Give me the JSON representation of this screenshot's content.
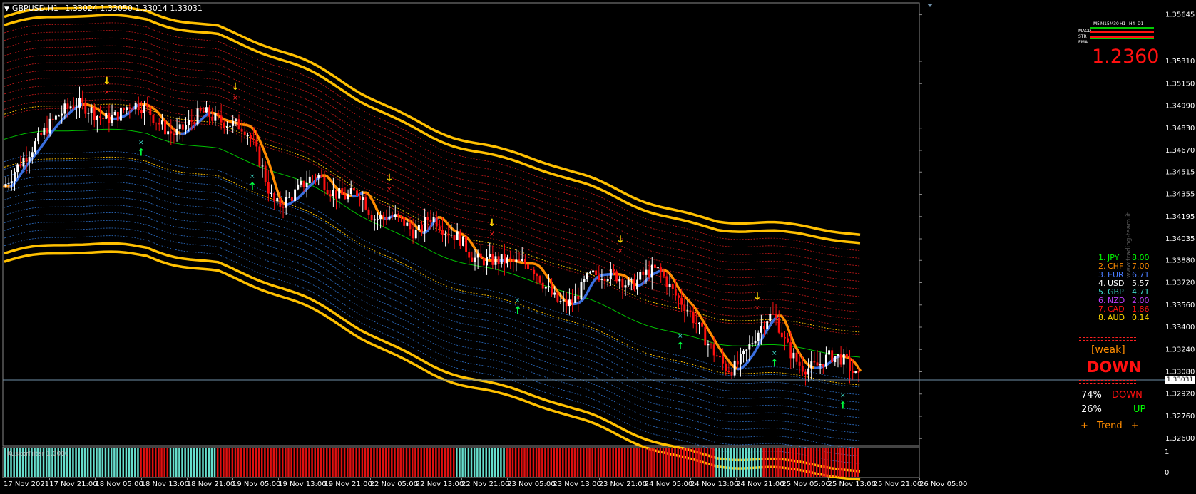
{
  "header": {
    "symbol_tf": "GBPUSD,H1",
    "ohlc": "1.33024 1.33050 1.33014 1.33031"
  },
  "price_axis": {
    "ticks": [
      "1.35645",
      "1.35310",
      "1.35150",
      "1.34990",
      "1.34830",
      "1.34670",
      "1.34515",
      "1.34355",
      "1.34195",
      "1.34035",
      "1.33880",
      "1.33720",
      "1.33560",
      "1.33400",
      "1.33240",
      "1.33080",
      "1.32920",
      "1.32760",
      "1.32600"
    ],
    "current": "1.33031"
  },
  "time_axis": {
    "labels": [
      "17 Nov 2021",
      "17 Nov 21:00",
      "18 Nov 05:00",
      "18 Nov 13:00",
      "18 Nov 21:00",
      "19 Nov 05:00",
      "19 Nov 13:00",
      "19 Nov 21:00",
      "22 Nov 05:00",
      "22 Nov 13:00",
      "22 Nov 21:00",
      "23 Nov 05:00",
      "23 Nov 13:00",
      "23 Nov 21:00",
      "24 Nov 05:00",
      "24 Nov 13:00",
      "24 Nov 21:00",
      "25 Nov 05:00",
      "25 Nov 13:00",
      "25 Nov 21:00",
      "26 Nov 05:00"
    ]
  },
  "chart_data": {
    "type": "candlestick",
    "symbol": "GBPUSD",
    "timeframe": "H1",
    "ylim": [
      1.3255,
      1.3573
    ],
    "close_path": [
      1.3441,
      1.3455,
      1.3468,
      1.3482,
      1.3493,
      1.35,
      1.3497,
      1.349,
      1.3492,
      1.35,
      1.3497,
      1.3486,
      1.3479,
      1.3486,
      1.3494,
      1.3489,
      1.3486,
      1.3482,
      1.346,
      1.343,
      1.3432,
      1.3442,
      1.3449,
      1.3438,
      1.3434,
      1.3436,
      1.3419,
      1.342,
      1.3416,
      1.3408,
      1.3419,
      1.341,
      1.3404,
      1.339,
      1.3388,
      1.3388,
      1.3386,
      1.3384,
      1.337,
      1.3358,
      1.3359,
      1.3375,
      1.3378,
      1.3377,
      1.337,
      1.3378,
      1.338,
      1.3365,
      1.3353,
      1.3336,
      1.332,
      1.331,
      1.332,
      1.3338,
      1.3348,
      1.3326,
      1.3312,
      1.3312,
      1.3319,
      1.3316,
      1.3303
    ],
    "current_price": 1.33031
  },
  "right_panel": {
    "tf_headers": [
      "M5",
      "M15",
      "M30",
      "H1",
      "H4",
      "D1"
    ],
    "indicators": [
      "MACD",
      "STR",
      "EMA"
    ],
    "big_value": "1.2360",
    "currencies": [
      {
        "rank": "1.",
        "name": "JPY",
        "value": "8.00",
        "color": "#00ff00"
      },
      {
        "rank": "2.",
        "name": "CHF",
        "value": "7.00",
        "color": "#ff8c00"
      },
      {
        "rank": "3.",
        "name": "EUR",
        "value": "6.71",
        "color": "#4a7cff"
      },
      {
        "rank": "4.",
        "name": "USD",
        "value": "5.57",
        "color": "#ffffff"
      },
      {
        "rank": "5.",
        "name": "GBP",
        "value": "4.71",
        "color": "#40e0d0"
      },
      {
        "rank": "6.",
        "name": "NZD",
        "value": "2.00",
        "color": "#c040ff"
      },
      {
        "rank": "7.",
        "name": "CAD",
        "value": "1.86",
        "color": "#ff1010"
      },
      {
        "rank": "8.",
        "name": "AUD",
        "value": "0.14",
        "color": "#ffd700"
      }
    ],
    "weak_label": "[weak]",
    "down_label": "DOWN",
    "down_pct": "74%",
    "down_word": "DOWN",
    "up_pct": "26%",
    "up_word": "UP",
    "trend_plus_left": "+",
    "trend_word": "Trend",
    "trend_plus_right": "+",
    "watermark": "www.trading-team.it"
  },
  "subwindow": {
    "label": "KuskorFilter 1.0000",
    "axis_top": "1",
    "axis_bottom": "0"
  },
  "colors": {
    "bull_candle": "#ffffff",
    "bear_candle": "#ff1010",
    "band_outer": "#ffc000",
    "upper_dotted": "#ff2020",
    "lower_dotted": "#3a8fff",
    "ma_green": "#00c000",
    "ma_orange": "#ff8c00",
    "ma_blue": "#3a6fe0",
    "hist_cyan": "#66ddcc",
    "hist_red": "#e01010"
  }
}
